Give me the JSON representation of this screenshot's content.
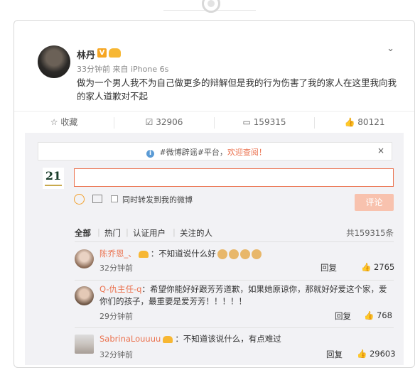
{
  "post": {
    "author": "林丹",
    "verified": "V",
    "meta": "33分钟前 来自 iPhone 6s",
    "text": "做为一个男人我不为自己做更多的辩解但是我的行为伤害了我的家人在这里我向我的家人道歉对不起",
    "menu_icon": "chevron-down-icon"
  },
  "actions": {
    "favorite": "☆ 收藏",
    "repost": "32906",
    "comment": "159315",
    "like": "80121"
  },
  "notice": {
    "prefix": "#微博辟谣#平台，",
    "highlight": "欢迎查阅！",
    "close": "×"
  },
  "composer": {
    "logo_text": "21",
    "repost_option": "同时转发到我的微博",
    "submit": "评论"
  },
  "filters": {
    "all": "全部",
    "hot": "热门",
    "verified": "认证用户",
    "following": "关注的人",
    "total": "共159315条"
  },
  "comments": [
    {
      "name": "陈乔恩_、",
      "text": "：不知道说什么好",
      "time": "32分钟前",
      "reply": "回复",
      "likes": "2765"
    },
    {
      "name": "Q-仇主任-q",
      "text": "：希望你能好好跟芳芳道歉，如果她原谅你，那就好好爱这个家，爱你们的孩子，最重要是爱芳芳！！！！！",
      "time": "29分钟前",
      "reply": "回复",
      "likes": "768"
    },
    {
      "name": "SabrinaLouuuu",
      "text": "：不知道该说什么，有点难过",
      "time": "32分钟前",
      "reply": "回复",
      "likes": "29603"
    }
  ],
  "colors": {
    "accent": "#eb7350",
    "section_bg": "#f2f2f5",
    "submit_disabled": "#f8c2ae"
  }
}
